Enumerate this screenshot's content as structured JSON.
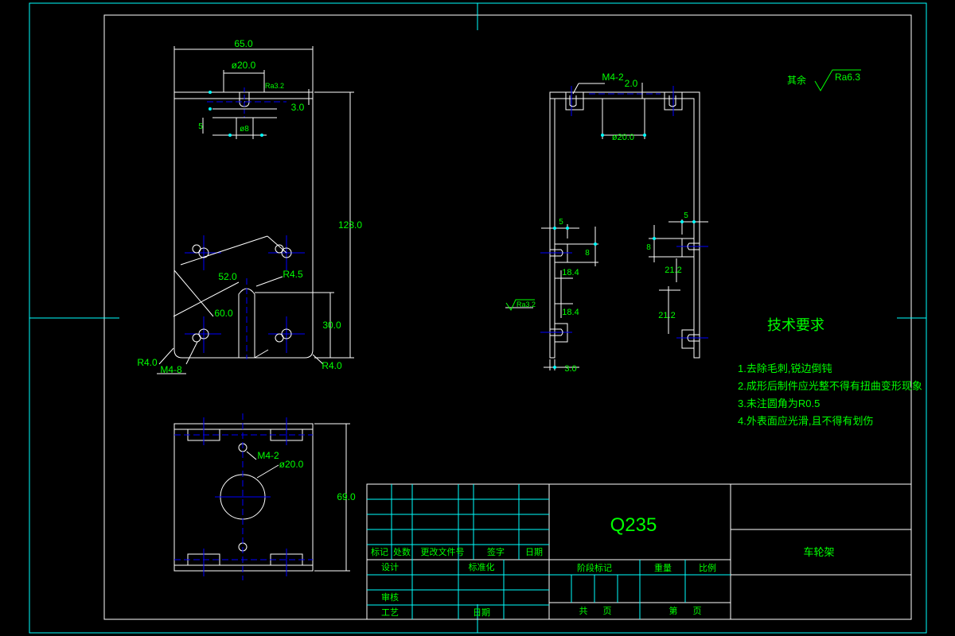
{
  "colors": {
    "background": "#000000",
    "outline": "#ffffff",
    "dimension": "#00ff00",
    "frame": "#00ffff",
    "centerline": "#0000ff",
    "annotation_text": "#00ff00"
  },
  "drawing": {
    "material": "Q235",
    "part_name": "车轮架"
  },
  "front_view": {
    "width_dim": "65.0",
    "hole_spacing_dim": "ø20.0",
    "roughness_label": "Ra3.2",
    "depth_dim": "3.0",
    "slot_width_dim": "ø8",
    "slot_offset_dim": "5",
    "height_dim": "123.0",
    "diag_dim_a": "52.0",
    "diag_dim_b": "60.0",
    "slot_radius": "R4.5",
    "slot_height_dim": "30.0",
    "corner_radius_left": "R4.0",
    "corner_radius_right": "R4.0",
    "thread_callout": "M4-8"
  },
  "side_view": {
    "thread_callout": "M4-2",
    "top_offset_dim": "2.0",
    "hole_spacing_dim": "ø20.0",
    "left_offset_dim": "5",
    "left_hole_dim": "8",
    "left_spacing_1": "18.4",
    "left_spacing_2": "18.4",
    "roughness_label": "Ra3.2",
    "thickness_dim": "3.0",
    "right_offset_dim": "5",
    "right_hole_dim": "8",
    "right_spacing_1": "21.2",
    "right_spacing_2": "21.2"
  },
  "bottom_view": {
    "thread_callout": "M4-2",
    "hole_dim": "ø20.0",
    "height_dim": "69.0"
  },
  "surface_finish": {
    "label": "其余",
    "value": "Ra6.3"
  },
  "tech_requirements": {
    "title": "技术要求",
    "items": [
      "1.去除毛刺,锐边倒钝",
      "2.成形后制件应光整不得有扭曲变形现象",
      "3.未注圆角为R0.5",
      "4.外表面应光滑,且不得有划伤"
    ]
  },
  "title_block": {
    "revision_labels": [
      "标记",
      "处数",
      "更改文件号",
      "签字",
      "日期"
    ],
    "design_label": "设计",
    "standardization_label": "标准化",
    "review_label": "审核",
    "process_label": "工艺",
    "date_label": "日期",
    "stage_mark_label": "阶段标记",
    "weight_label": "重量",
    "scale_label": "比例",
    "total_label": "共",
    "sheet_label": "第",
    "page_label": "页",
    "page_label_2": "页"
  }
}
